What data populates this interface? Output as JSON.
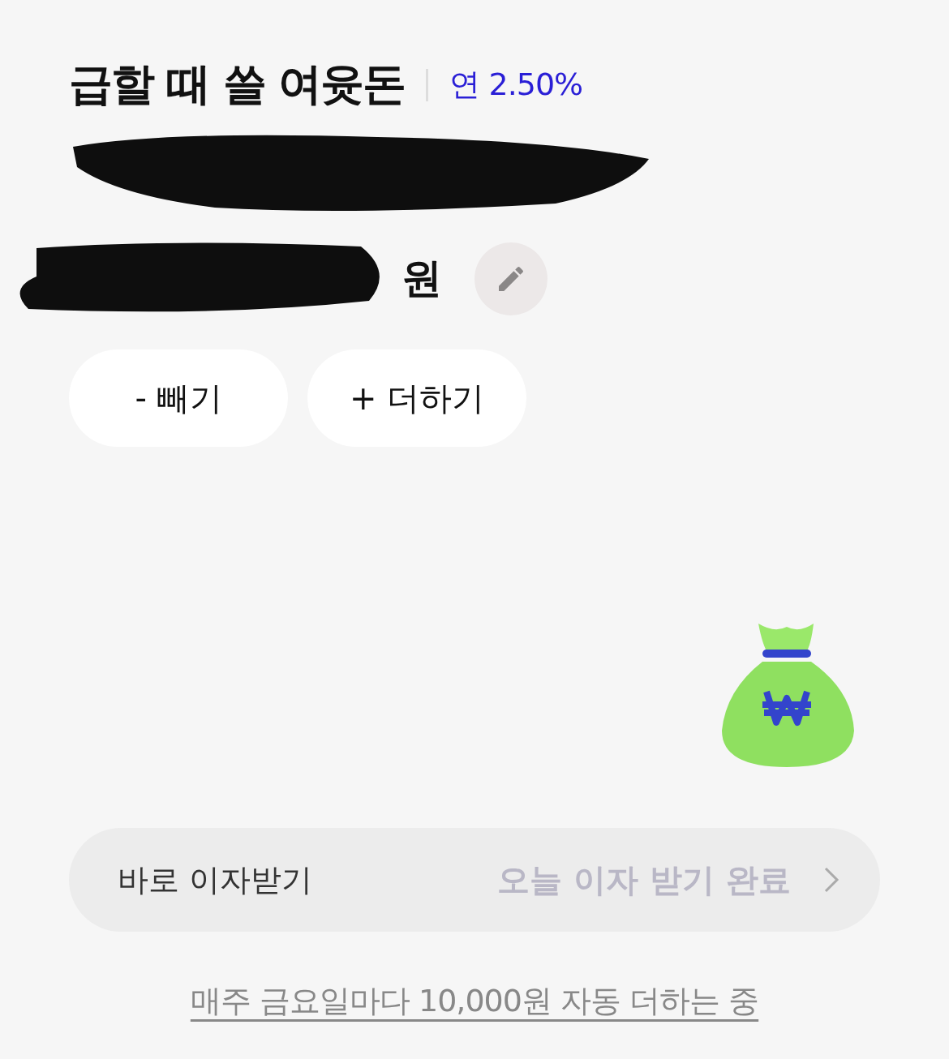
{
  "title": "급할 때 쓸 여윳돈",
  "rate": "연 2.50%",
  "balance": {
    "unit": "원"
  },
  "actions": [
    {
      "label": "- 빼기"
    },
    {
      "label": "+ 더하기"
    }
  ],
  "interest": {
    "label": "바로 이자받기",
    "status": "오늘 이자 받기 완료",
    "disabled": true
  },
  "footer_link": "매주 금요일마다 10,000원 자동 더하는 중"
}
